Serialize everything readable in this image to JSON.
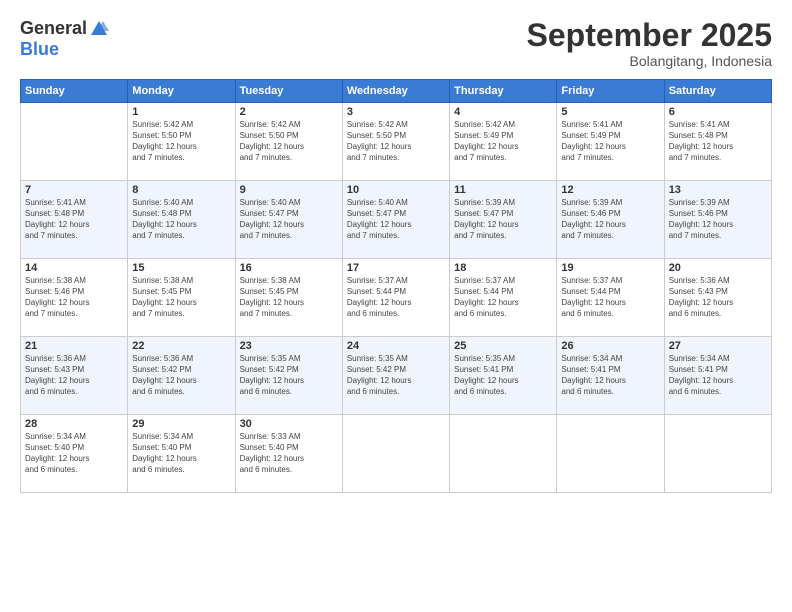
{
  "logo": {
    "general": "General",
    "blue": "Blue"
  },
  "header": {
    "month": "September 2025",
    "location": "Bolangitang, Indonesia"
  },
  "weekdays": [
    "Sunday",
    "Monday",
    "Tuesday",
    "Wednesday",
    "Thursday",
    "Friday",
    "Saturday"
  ],
  "weeks": [
    [
      {
        "day": "",
        "info": ""
      },
      {
        "day": "1",
        "info": "Sunrise: 5:42 AM\nSunset: 5:50 PM\nDaylight: 12 hours\nand 7 minutes."
      },
      {
        "day": "2",
        "info": "Sunrise: 5:42 AM\nSunset: 5:50 PM\nDaylight: 12 hours\nand 7 minutes."
      },
      {
        "day": "3",
        "info": "Sunrise: 5:42 AM\nSunset: 5:50 PM\nDaylight: 12 hours\nand 7 minutes."
      },
      {
        "day": "4",
        "info": "Sunrise: 5:42 AM\nSunset: 5:49 PM\nDaylight: 12 hours\nand 7 minutes."
      },
      {
        "day": "5",
        "info": "Sunrise: 5:41 AM\nSunset: 5:49 PM\nDaylight: 12 hours\nand 7 minutes."
      },
      {
        "day": "6",
        "info": "Sunrise: 5:41 AM\nSunset: 5:48 PM\nDaylight: 12 hours\nand 7 minutes."
      }
    ],
    [
      {
        "day": "7",
        "info": "Sunrise: 5:41 AM\nSunset: 5:48 PM\nDaylight: 12 hours\nand 7 minutes."
      },
      {
        "day": "8",
        "info": "Sunrise: 5:40 AM\nSunset: 5:48 PM\nDaylight: 12 hours\nand 7 minutes."
      },
      {
        "day": "9",
        "info": "Sunrise: 5:40 AM\nSunset: 5:47 PM\nDaylight: 12 hours\nand 7 minutes."
      },
      {
        "day": "10",
        "info": "Sunrise: 5:40 AM\nSunset: 5:47 PM\nDaylight: 12 hours\nand 7 minutes."
      },
      {
        "day": "11",
        "info": "Sunrise: 5:39 AM\nSunset: 5:47 PM\nDaylight: 12 hours\nand 7 minutes."
      },
      {
        "day": "12",
        "info": "Sunrise: 5:39 AM\nSunset: 5:46 PM\nDaylight: 12 hours\nand 7 minutes."
      },
      {
        "day": "13",
        "info": "Sunrise: 5:39 AM\nSunset: 5:46 PM\nDaylight: 12 hours\nand 7 minutes."
      }
    ],
    [
      {
        "day": "14",
        "info": "Sunrise: 5:38 AM\nSunset: 5:46 PM\nDaylight: 12 hours\nand 7 minutes."
      },
      {
        "day": "15",
        "info": "Sunrise: 5:38 AM\nSunset: 5:45 PM\nDaylight: 12 hours\nand 7 minutes."
      },
      {
        "day": "16",
        "info": "Sunrise: 5:38 AM\nSunset: 5:45 PM\nDaylight: 12 hours\nand 7 minutes."
      },
      {
        "day": "17",
        "info": "Sunrise: 5:37 AM\nSunset: 5:44 PM\nDaylight: 12 hours\nand 6 minutes."
      },
      {
        "day": "18",
        "info": "Sunrise: 5:37 AM\nSunset: 5:44 PM\nDaylight: 12 hours\nand 6 minutes."
      },
      {
        "day": "19",
        "info": "Sunrise: 5:37 AM\nSunset: 5:44 PM\nDaylight: 12 hours\nand 6 minutes."
      },
      {
        "day": "20",
        "info": "Sunrise: 5:36 AM\nSunset: 5:43 PM\nDaylight: 12 hours\nand 6 minutes."
      }
    ],
    [
      {
        "day": "21",
        "info": "Sunrise: 5:36 AM\nSunset: 5:43 PM\nDaylight: 12 hours\nand 6 minutes."
      },
      {
        "day": "22",
        "info": "Sunrise: 5:36 AM\nSunset: 5:42 PM\nDaylight: 12 hours\nand 6 minutes."
      },
      {
        "day": "23",
        "info": "Sunrise: 5:35 AM\nSunset: 5:42 PM\nDaylight: 12 hours\nand 6 minutes."
      },
      {
        "day": "24",
        "info": "Sunrise: 5:35 AM\nSunset: 5:42 PM\nDaylight: 12 hours\nand 6 minutes."
      },
      {
        "day": "25",
        "info": "Sunrise: 5:35 AM\nSunset: 5:41 PM\nDaylight: 12 hours\nand 6 minutes."
      },
      {
        "day": "26",
        "info": "Sunrise: 5:34 AM\nSunset: 5:41 PM\nDaylight: 12 hours\nand 6 minutes."
      },
      {
        "day": "27",
        "info": "Sunrise: 5:34 AM\nSunset: 5:41 PM\nDaylight: 12 hours\nand 6 minutes."
      }
    ],
    [
      {
        "day": "28",
        "info": "Sunrise: 5:34 AM\nSunset: 5:40 PM\nDaylight: 12 hours\nand 6 minutes."
      },
      {
        "day": "29",
        "info": "Sunrise: 5:34 AM\nSunset: 5:40 PM\nDaylight: 12 hours\nand 6 minutes."
      },
      {
        "day": "30",
        "info": "Sunrise: 5:33 AM\nSunset: 5:40 PM\nDaylight: 12 hours\nand 6 minutes."
      },
      {
        "day": "",
        "info": ""
      },
      {
        "day": "",
        "info": ""
      },
      {
        "day": "",
        "info": ""
      },
      {
        "day": "",
        "info": ""
      }
    ]
  ]
}
